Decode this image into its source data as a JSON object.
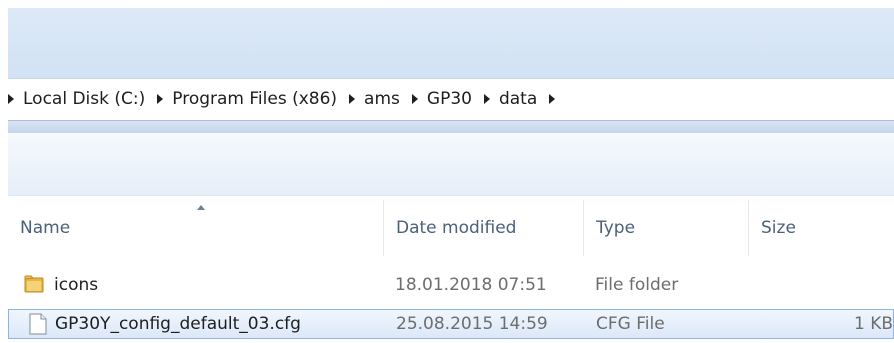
{
  "address_bar": {
    "segments": [
      "Local Disk (C:)",
      "Program Files (x86)",
      "ams",
      "GP30",
      "data"
    ]
  },
  "columns": {
    "name": "Name",
    "date_modified": "Date modified",
    "type": "Type",
    "size": "Size"
  },
  "files": [
    {
      "name": "icons",
      "date": "18.01.2018 07:51",
      "type": "File folder",
      "size": "",
      "icon": "folder-icon"
    },
    {
      "name": "GP30Y_config_default_03.cfg",
      "date": "25.08.2015 14:59",
      "type": "CFG File",
      "size": "1 KB",
      "icon": "file-icon",
      "selected": true
    }
  ],
  "colors": {
    "header_blue": "#d6e5f5",
    "selection_border": "#8fb3e6",
    "column_header_text": "#4c607a"
  }
}
